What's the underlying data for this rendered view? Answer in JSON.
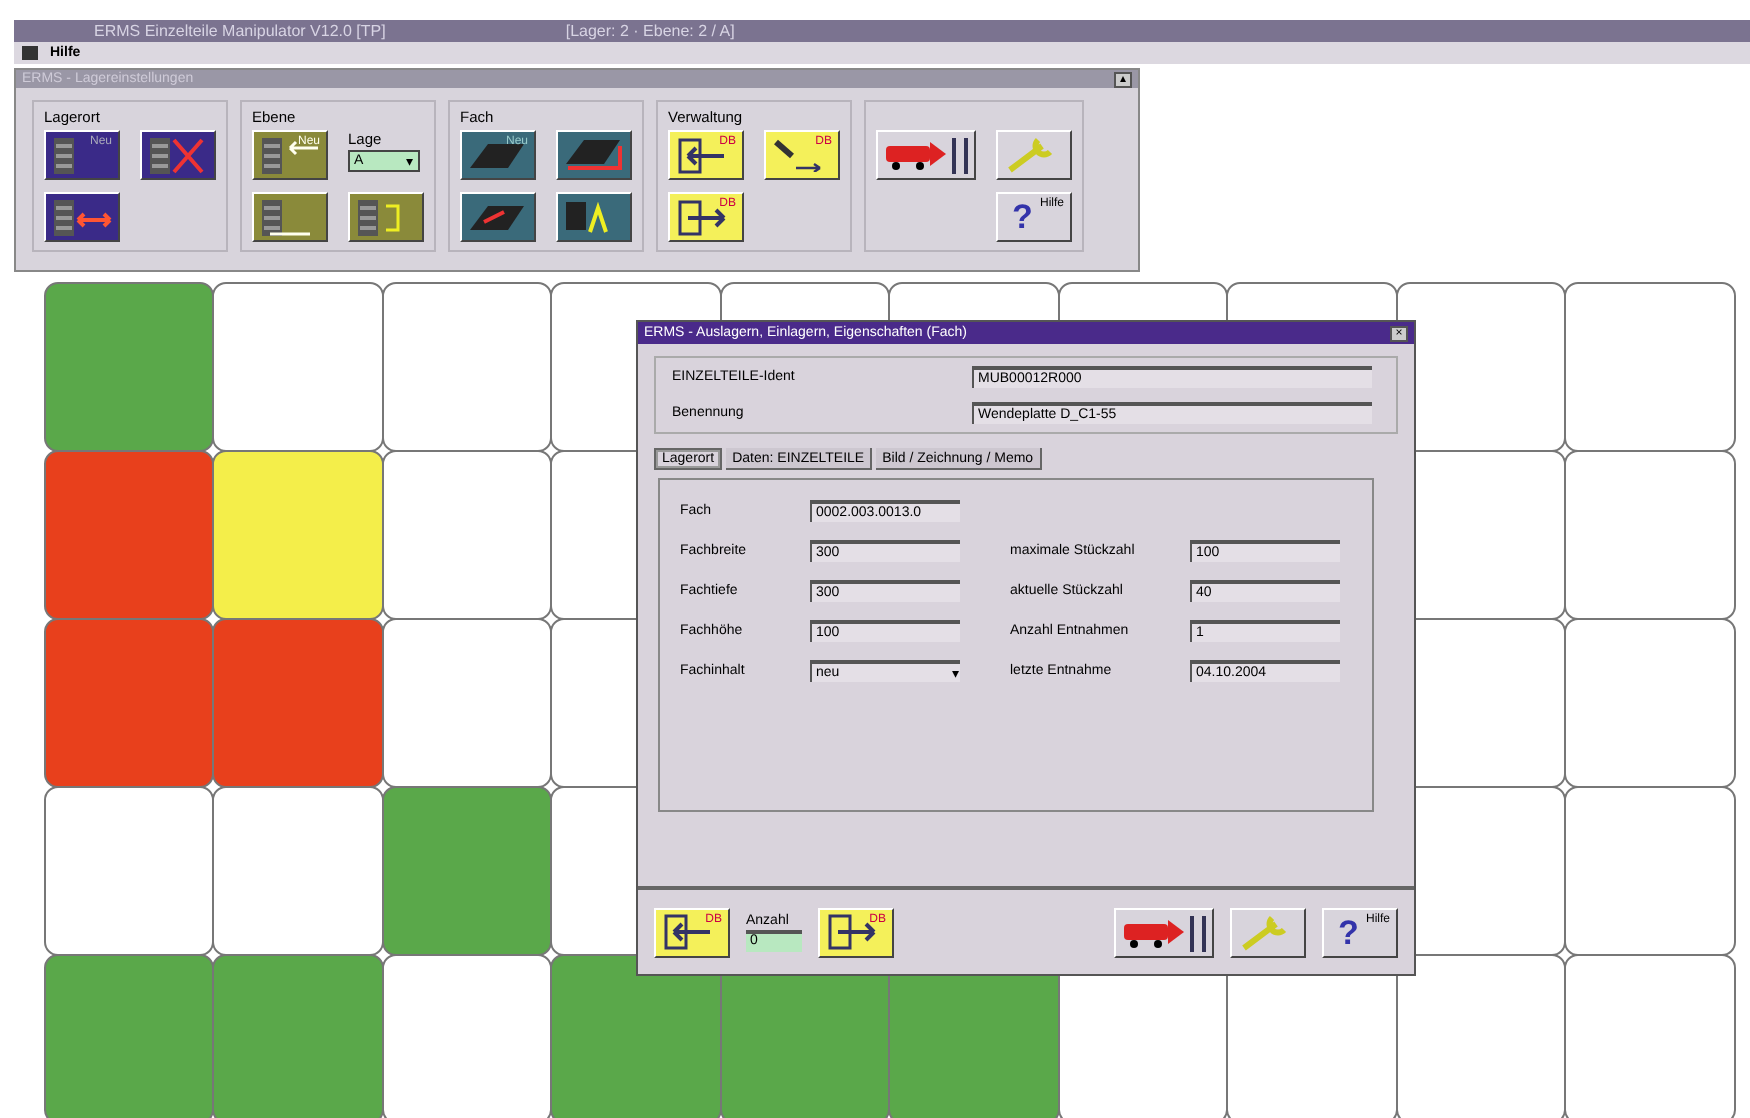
{
  "window": {
    "title": "ERMS Einzelteile Manipulator V12.0 [TP]",
    "status": "[Lager: 2 · Ebene: 2 / A]"
  },
  "menu": [
    "Hilfe"
  ],
  "toolbar": {
    "title": "ERMS - Lagereinstellungen",
    "close": "▴",
    "groups": [
      {
        "label": "Lagerort",
        "buttons": [
          {
            "kind": "shelf-add",
            "label": "Neu"
          },
          {
            "kind": "shelf-delete"
          },
          {
            "kind": "shelf-move"
          }
        ]
      },
      {
        "label": "Ebene",
        "buttons": [
          {
            "kind": "level-add",
            "label": "Neu"
          },
          {
            "kind": "level-remove"
          },
          {
            "kind": "level-insert"
          }
        ],
        "select": {
          "label": "Lage",
          "value": "A",
          "arrow": "▾"
        }
      },
      {
        "label": "Fach",
        "buttons": [
          {
            "kind": "tray-add",
            "label": "Neu"
          },
          {
            "kind": "tray-move"
          },
          {
            "kind": "tray-remove"
          },
          {
            "kind": "tray-label"
          }
        ]
      },
      {
        "label": "Verwaltung",
        "buttons": [
          {
            "kind": "db-in",
            "label": "DB"
          },
          {
            "kind": "db-copy",
            "label": "DB"
          },
          {
            "kind": "db-out",
            "label": "DB"
          }
        ]
      },
      {
        "buttons": [
          {
            "kind": "truck"
          },
          {
            "kind": "wrench"
          },
          {
            "kind": "help",
            "glyph": "?",
            "label": "Hilfe"
          }
        ]
      }
    ]
  },
  "grid": {
    "rows": [
      [
        {
          "color": "#5aa84a"
        },
        {
          "color": "#ffffff"
        },
        {
          "color": "#ffffff"
        },
        {
          "color": "#ffffff"
        },
        {
          "color": "#ffffff"
        },
        {
          "color": "#ffffff"
        },
        {
          "color": "#ffffff"
        },
        {
          "color": "#ffffff"
        },
        {
          "color": "#ffffff"
        },
        {
          "color": "#ffffff"
        }
      ],
      [
        {
          "color": "#e8401c"
        },
        {
          "color": "#f4ee4a"
        },
        {
          "color": "#ffffff"
        },
        {
          "color": "#ffffff"
        },
        null,
        null,
        null,
        null,
        {
          "color": "#ffffff"
        },
        {
          "color": "#ffffff"
        }
      ],
      [
        {
          "color": "#e8401c"
        },
        {
          "color": "#e8401c"
        },
        {
          "color": "#ffffff"
        },
        {
          "color": "#ffffff"
        },
        null,
        null,
        null,
        null,
        {
          "color": "#ffffff"
        },
        {
          "color": "#ffffff"
        }
      ],
      [
        {
          "color": "#ffffff"
        },
        {
          "color": "#ffffff"
        },
        {
          "color": "#5aa84a"
        },
        {
          "color": "#ffffff"
        },
        null,
        null,
        null,
        null,
        {
          "color": "#ffffff"
        },
        {
          "color": "#ffffff"
        }
      ],
      [
        {
          "color": "#5aa84a"
        },
        {
          "color": "#5aa84a"
        },
        {
          "color": "#ffffff"
        },
        {
          "color": "#5aa84a"
        },
        {
          "color": "#5aa84a"
        },
        {
          "color": "#5aa84a"
        },
        {
          "color": "#ffffff"
        },
        {
          "color": "#ffffff"
        },
        {
          "color": "#ffffff"
        },
        {
          "color": "#ffffff"
        }
      ]
    ]
  },
  "dialog": {
    "title": "ERMS - Auslagern, Einlagern, Eigenschaften (Fach)",
    "close": "×",
    "header": [
      {
        "label": "EINZELTEILE-Ident",
        "value": "MUB00012R000"
      },
      {
        "label": "Benennung",
        "value": "Wendeplatte D_C1-55"
      }
    ],
    "tabs": [
      {
        "label": "Lagerort",
        "selected": true
      },
      {
        "label": "Daten: EINZELTEILE",
        "selected": false
      },
      {
        "label": "Bild / Zeichnung / Memo",
        "selected": false
      }
    ],
    "left_fields": [
      {
        "label": "Fach",
        "value": "0002.003.0013.0",
        "kind": "text"
      },
      {
        "label": "Fachbreite",
        "value": "300",
        "kind": "text"
      },
      {
        "label": "Fachtiefe",
        "value": "300",
        "kind": "text"
      },
      {
        "label": "Fachhöhe",
        "value": "100",
        "kind": "text"
      },
      {
        "label": "Fachinhalt",
        "value": "neu",
        "kind": "select",
        "arrow": "▾"
      }
    ],
    "right_fields": [
      {
        "label": "maximale Stückzahl",
        "value": "100"
      },
      {
        "label": "aktuelle Stückzahl",
        "value": "40"
      },
      {
        "label": "Anzahl Entnahmen",
        "value": "1"
      },
      {
        "label": "letzte Entnahme",
        "value": "04.10.2004"
      }
    ],
    "footer": {
      "left": [
        {
          "kind": "db-in",
          "label": "DB"
        },
        {
          "kind": "db-out",
          "label": "DB"
        }
      ],
      "quantity": {
        "label": "Anzahl",
        "value": "0"
      },
      "right": [
        {
          "kind": "truck"
        },
        {
          "kind": "wrench"
        },
        {
          "kind": "help",
          "glyph": "?",
          "label": "Hilfe"
        }
      ]
    }
  }
}
